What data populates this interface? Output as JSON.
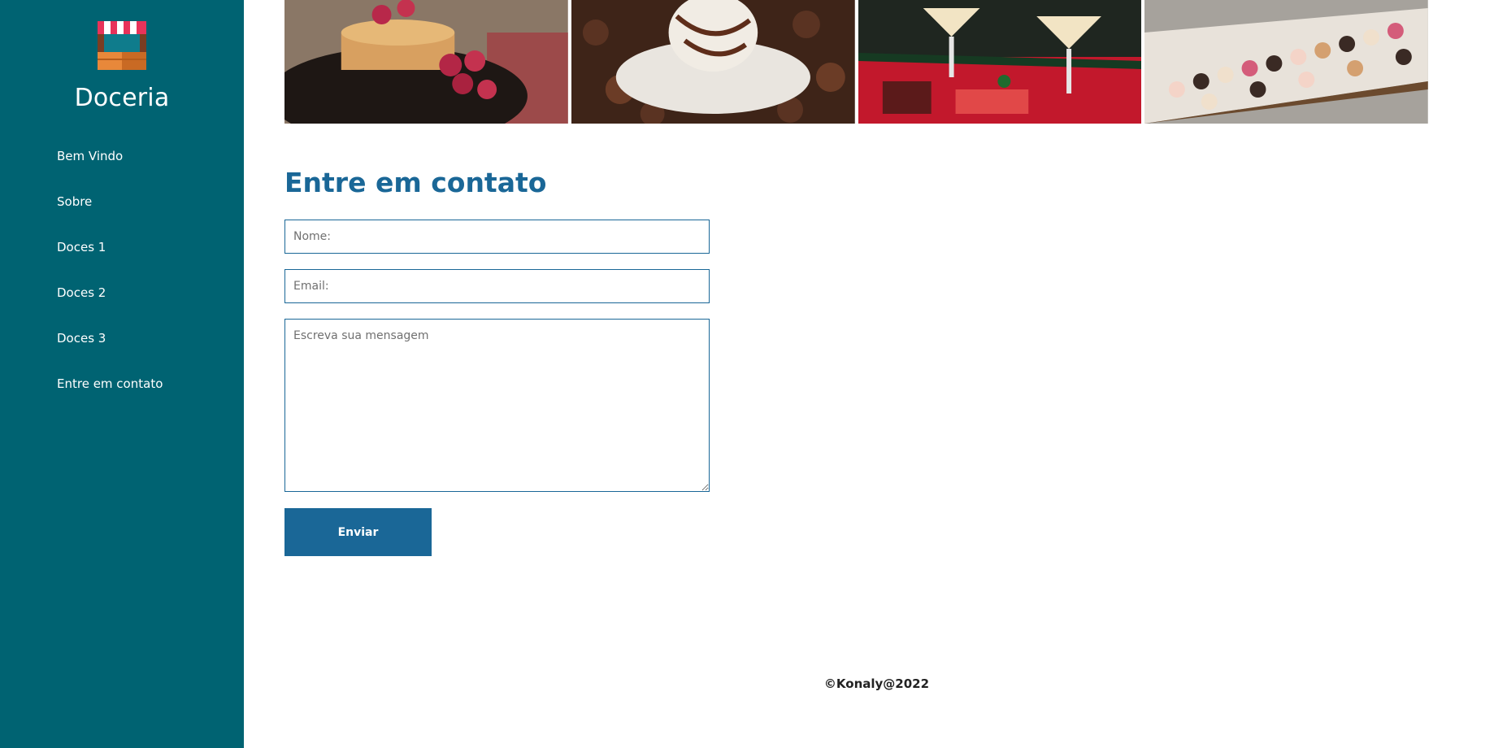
{
  "sidebar": {
    "brand": "Doceria",
    "logo_icon": "shop-stall-icon",
    "items": [
      {
        "label": "Bem Vindo"
      },
      {
        "label": "Sobre"
      },
      {
        "label": "Doces 1"
      },
      {
        "label": "Doces 2"
      },
      {
        "label": "Doces 3"
      },
      {
        "label": "Entre em contato"
      }
    ]
  },
  "gallery": {
    "images": [
      {
        "subject": "pancakes-with-raspberries"
      },
      {
        "subject": "chocolate-dessert-with-coconut"
      },
      {
        "subject": "christmas-desserts-and-cocktails"
      },
      {
        "subject": "donut-table"
      }
    ]
  },
  "contact": {
    "title": "Entre em contato",
    "name_placeholder": "Nome:",
    "email_placeholder": "Email:",
    "message_placeholder": "Escreva sua mensagem",
    "submit_label": "Enviar"
  },
  "footer": {
    "text": "©Konaly@2022"
  },
  "colors": {
    "sidebar_bg": "#006372",
    "accent": "#1a6797",
    "text_dark": "#222222"
  }
}
